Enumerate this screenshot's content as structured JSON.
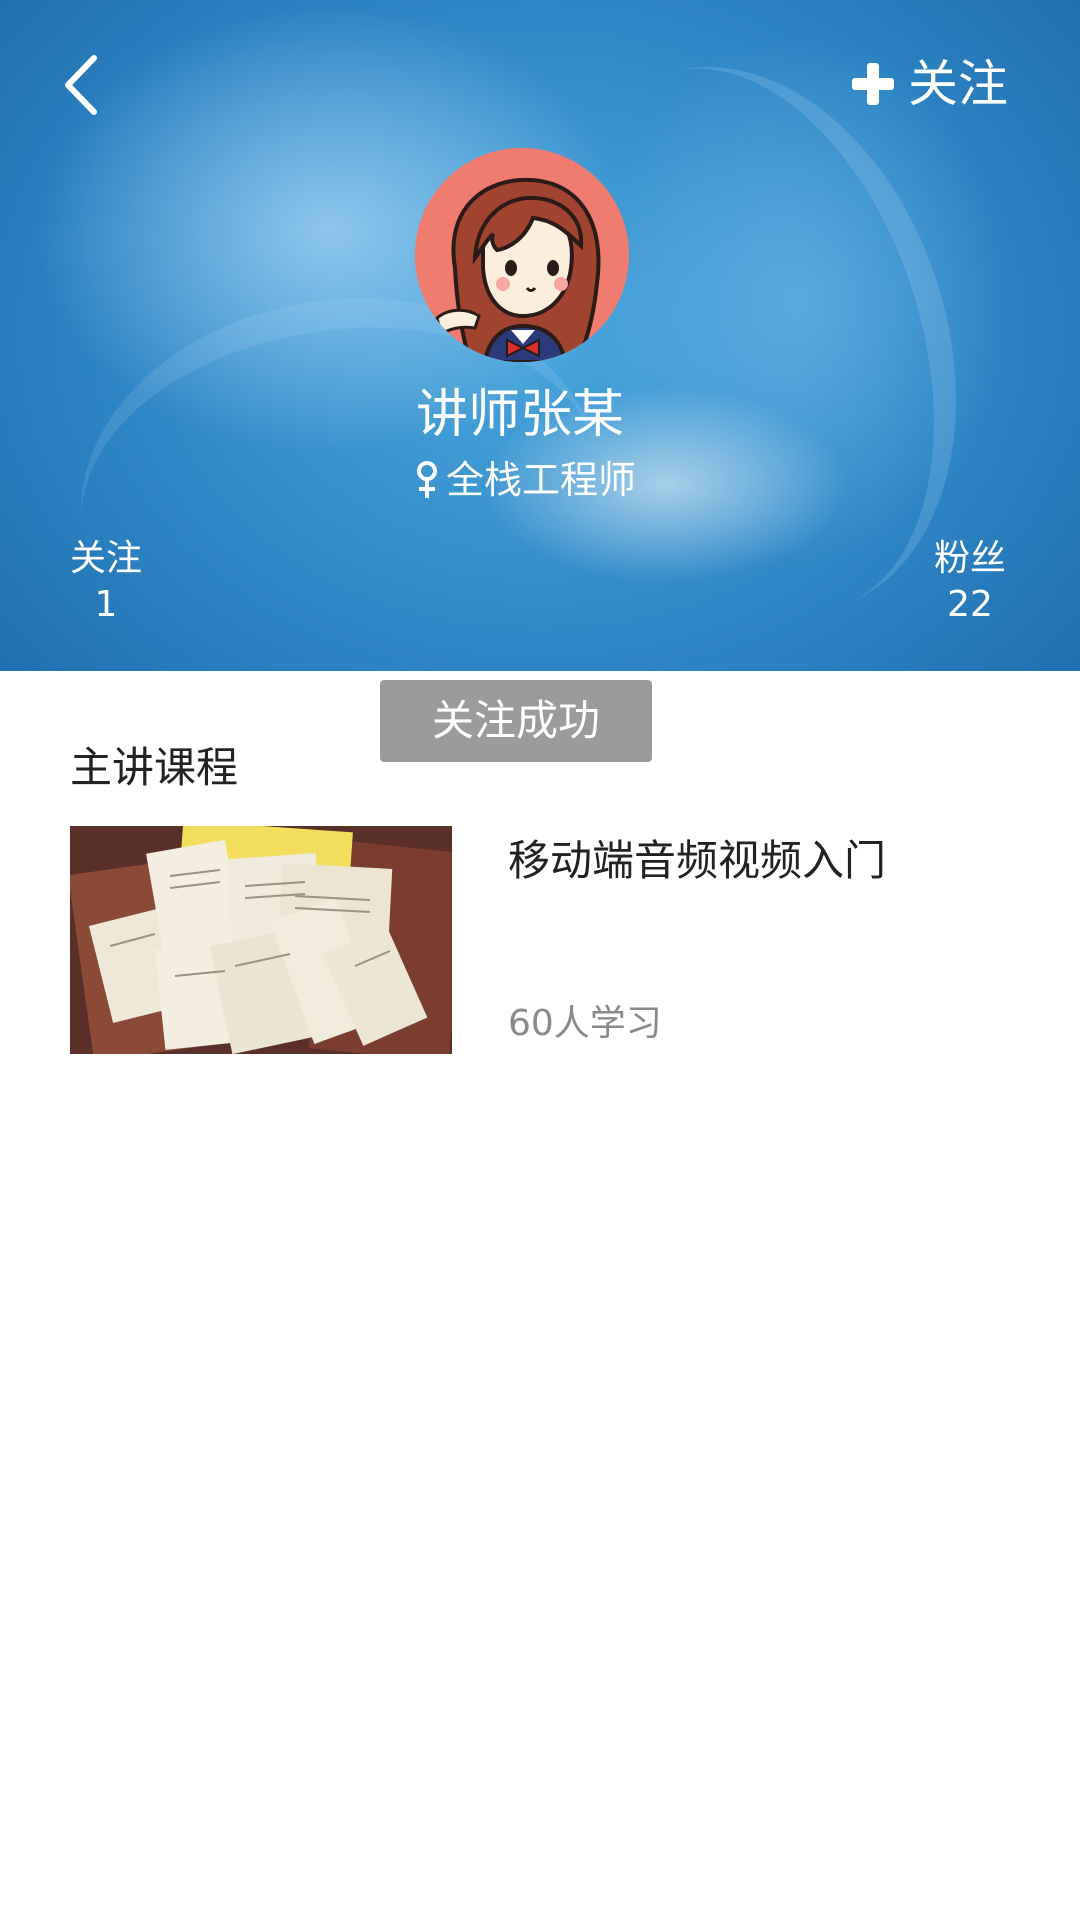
{
  "header": {
    "follow_label": "关注",
    "teacher_name": "讲师张某",
    "teacher_title": "全栈工程师",
    "stats": {
      "following_label": "关注",
      "following_count": "1",
      "fans_label": "粉丝",
      "fans_count": "22"
    }
  },
  "toast": {
    "message": "关注成功"
  },
  "courses": {
    "section_title": "主讲课程",
    "items": [
      {
        "title": "移动端音频视频入门",
        "learners": "60人学习"
      }
    ]
  },
  "colors": {
    "header_blue": "#2a80c0",
    "avatar_bg": "#f07b6f",
    "toast_bg": "#9b9b9b"
  },
  "icons": [
    "back-arrow-icon",
    "plus-icon",
    "female-icon"
  ]
}
